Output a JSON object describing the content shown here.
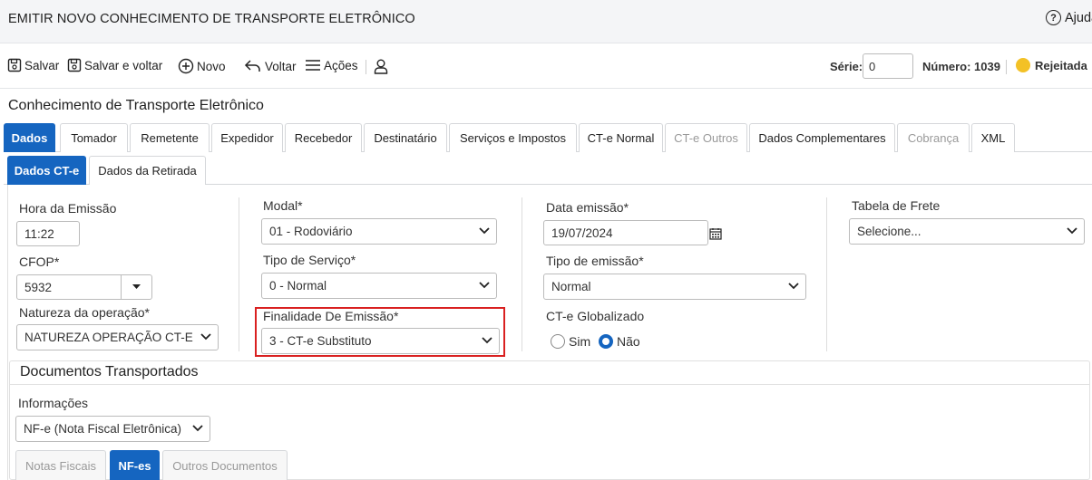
{
  "header": {
    "title": "EMITIR NOVO CONHECIMENTO DE TRANSPORTE ELETRÔNICO",
    "help_label": "Ajuda"
  },
  "toolbar": {
    "save_label": "Salvar",
    "save_back_label": "Salvar e voltar",
    "new_label": "Novo",
    "back_label": "Voltar",
    "actions_label": "Ações",
    "serie_label": "Série:",
    "serie_value": "0",
    "numero_label": "Número: 1039",
    "status_label": "Rejeitada",
    "status_color": "#f3c126"
  },
  "section_title": "Conhecimento de Transporte Eletrônico",
  "main_tabs": [
    {
      "label": "Dados",
      "state": "active"
    },
    {
      "label": "Tomador",
      "state": "normal"
    },
    {
      "label": "Remetente",
      "state": "normal"
    },
    {
      "label": "Expedidor",
      "state": "normal"
    },
    {
      "label": "Recebedor",
      "state": "normal"
    },
    {
      "label": "Destinatário",
      "state": "normal"
    },
    {
      "label": "Serviços e Impostos",
      "state": "normal"
    },
    {
      "label": "CT-e Normal",
      "state": "normal"
    },
    {
      "label": "CT-e Outros",
      "state": "disabled"
    },
    {
      "label": "Dados Complementares",
      "state": "normal"
    },
    {
      "label": "Cobrança",
      "state": "disabled"
    },
    {
      "label": "XML",
      "state": "normal"
    }
  ],
  "sub_tabs": [
    {
      "label": "Dados CT-e",
      "state": "active"
    },
    {
      "label": "Dados da Retirada",
      "state": "normal"
    }
  ],
  "form": {
    "hora_label": "Hora da Emissão",
    "hora_value": "11:22",
    "cfop_label": "CFOP*",
    "cfop_value": "5932",
    "natureza_label": "Natureza da operação*",
    "natureza_value": "NATUREZA OPERAÇÃO CT-E",
    "modal_label": "Modal*",
    "modal_value": "01 - Rodoviário",
    "tipo_servico_label": "Tipo de Serviço*",
    "tipo_servico_value": "0 - Normal",
    "finalidade_label": "Finalidade De Emissão*",
    "finalidade_value": "3 - CT-e Substituto",
    "data_label": "Data emissão*",
    "data_value": "19/07/2024",
    "tipo_emissao_label": "Tipo de emissão*",
    "tipo_emissao_value": "Normal",
    "globalizado_label": "CT-e Globalizado",
    "sim_label": "Sim",
    "nao_label": "Não",
    "tabela_frete_label": "Tabela de Frete",
    "tabela_frete_value": "Selecione..."
  },
  "documentos": {
    "title": "Documentos Transportados",
    "informacoes_label": "Informações",
    "informacoes_value": "NF-e (Nota Fiscal Eletrônica)",
    "tabs": [
      {
        "label": "Notas Fiscais",
        "state": "disabled"
      },
      {
        "label": "NF-es",
        "state": "active"
      },
      {
        "label": "Outros Documentos",
        "state": "disabled"
      }
    ]
  },
  "colors": {
    "accent": "#1565c0",
    "highlight_border": "#d92020"
  }
}
